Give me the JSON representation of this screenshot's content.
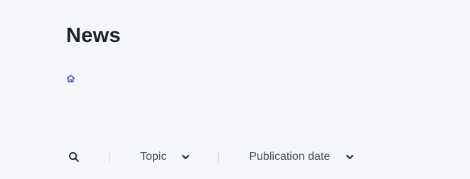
{
  "page": {
    "title": "News"
  },
  "breadcrumb": {
    "home_icon": "home-icon",
    "accent_color": "#3d55c9"
  },
  "filters": {
    "search_icon": "search-icon",
    "topic_label": "Topic",
    "publication_date_label": "Publication date",
    "dropdown_icon": "chevron-down-icon"
  },
  "colors": {
    "background": "#f5f6fa",
    "title": "#1e212b",
    "filter_text": "#4a4e5a",
    "divider": "#d3d6de"
  }
}
